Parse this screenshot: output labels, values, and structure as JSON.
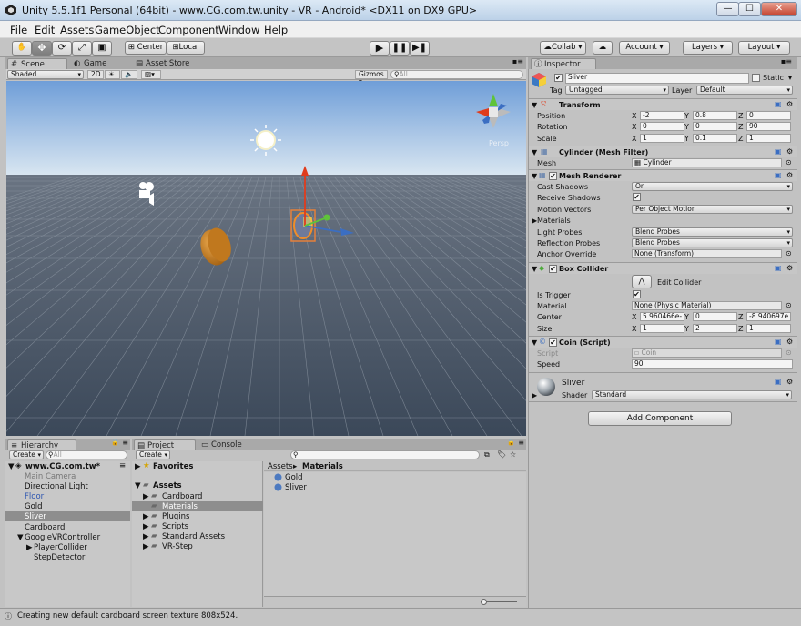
{
  "window": {
    "title": "Unity 5.5.1f1 Personal (64bit) - www.CG.com.tw.unity - VR - Android* <DX11 on DX9 GPU>",
    "minimize": "—",
    "maximize": "☐",
    "close": "✕"
  },
  "menu": [
    "File",
    "Edit",
    "Assets",
    "GameObject",
    "Component",
    "Window",
    "Help"
  ],
  "toolbar": {
    "center": "Center",
    "local": "Local",
    "collab": "Collab",
    "account": "Account",
    "layers": "Layers",
    "layout": "Layout"
  },
  "tabs": {
    "scene": "Scene",
    "game": "Game",
    "asset_store": "Asset Store",
    "inspector": "Inspector",
    "hierarchy": "Hierarchy",
    "project": "Project",
    "console": "Console"
  },
  "scene_toolbar": {
    "shading": "Shaded",
    "mode2d": "2D",
    "gizmos": "Gizmos",
    "search_placeholder": "All",
    "persp": "Persp"
  },
  "inspector": {
    "name": "Sliver",
    "static_label": "Static",
    "tag_label": "Tag",
    "tag_value": "Untagged",
    "layer_label": "Layer",
    "layer_value": "Default",
    "transform": {
      "title": "Transform",
      "position_label": "Position",
      "rotation_label": "Rotation",
      "scale_label": "Scale",
      "position": [
        "-2",
        "0.8",
        "0"
      ],
      "rotation": [
        "0",
        "0",
        "90"
      ],
      "scale": [
        "1",
        "0.1",
        "1"
      ]
    },
    "mesh_filter": {
      "title": "Cylinder (Mesh Filter)",
      "mesh_label": "Mesh",
      "mesh_value": "Cylinder"
    },
    "mesh_renderer": {
      "title": "Mesh Renderer",
      "rows": [
        {
          "label": "Cast Shadows",
          "value": "On",
          "kind": "dd"
        },
        {
          "label": "Receive Shadows",
          "value": "✔",
          "kind": "chk"
        },
        {
          "label": "Motion Vectors",
          "value": "Per Object Motion",
          "kind": "dd"
        },
        {
          "label": "Materials",
          "value": "",
          "kind": "fold"
        },
        {
          "label": "Light Probes",
          "value": "Blend Probes",
          "kind": "dd"
        },
        {
          "label": "Reflection Probes",
          "value": "Blend Probes",
          "kind": "dd"
        },
        {
          "label": "Anchor Override",
          "value": "None (Transform)",
          "kind": "obj"
        }
      ]
    },
    "box_collider": {
      "title": "Box Collider",
      "edit_label": "Edit Collider",
      "is_trigger_label": "Is Trigger",
      "is_trigger": "✔",
      "material_label": "Material",
      "material_value": "None (Physic Material)",
      "center_label": "Center",
      "size_label": "Size",
      "center": [
        "5.960466e-",
        "0",
        "-8.940697e"
      ],
      "size": [
        "1",
        "2",
        "1"
      ]
    },
    "script": {
      "title": "Coin (Script)",
      "script_label": "Script",
      "script_value": "Coin",
      "speed_label": "Speed",
      "speed_value": "90"
    },
    "material": {
      "name": "Sliver",
      "shader_label": "Shader",
      "shader_value": "Standard"
    },
    "add_component": "Add Component"
  },
  "hierarchy": {
    "create": "Create",
    "search_placeholder": "All",
    "scene": "www.CG.com.tw*",
    "items": [
      {
        "label": "Main Camera",
        "indent": 1,
        "style": "gray"
      },
      {
        "label": "Directional Light",
        "indent": 1,
        "style": "normal"
      },
      {
        "label": "Floor",
        "indent": 1,
        "style": "blue"
      },
      {
        "label": "Gold",
        "indent": 1,
        "style": "normal"
      },
      {
        "label": "Sliver",
        "indent": 1,
        "style": "selected"
      },
      {
        "label": "Cardboard",
        "indent": 1,
        "style": "normal"
      },
      {
        "label": "GoogleVRController",
        "indent": 1,
        "style": "fold"
      },
      {
        "label": "PlayerCollider",
        "indent": 2,
        "style": "fold"
      },
      {
        "label": "StepDetector",
        "indent": 2,
        "style": "normal"
      }
    ]
  },
  "project": {
    "create": "Create",
    "favorites": "Favorites",
    "assets": "Assets",
    "folders": [
      "Cardboard",
      "Materials",
      "Plugins",
      "Scripts",
      "Standard Assets",
      "VR-Step"
    ],
    "breadcrumb": [
      "Assets",
      "Materials"
    ],
    "files": [
      "Gold",
      "Sliver"
    ]
  },
  "status": "Creating new default cardboard screen texture 808x524.",
  "colors": {
    "sky_top": "#6f9ed8",
    "sky_horizon": "#d9e6f1",
    "ground": "#4c5a69",
    "gold_coin": "#c0781e",
    "accent_blue": "#3b6ec2"
  }
}
